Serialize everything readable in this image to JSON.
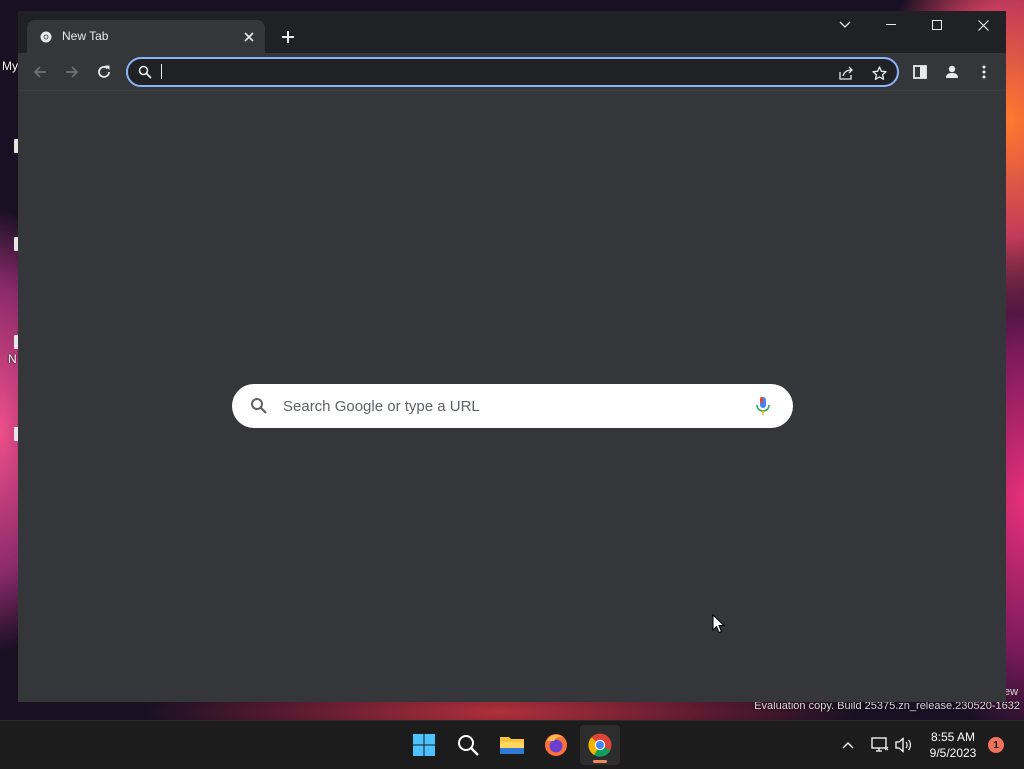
{
  "desktop": {
    "partial_label_top": "My",
    "partial_label_mid": "N",
    "watermark": "Evaluation copy. Build 25375.zn_release.230520-1632",
    "watermark_right": "ew"
  },
  "browser": {
    "tab": {
      "title": "New Tab",
      "favicon": "chrome-icon",
      "close_icon": "close-icon"
    },
    "new_tab_icon": "plus-icon",
    "window_controls": [
      "chevron-down-icon",
      "minimize-icon",
      "maximize-icon",
      "close-icon"
    ],
    "toolbar": {
      "back_icon": "arrow-left-icon",
      "forward_icon": "arrow-right-icon",
      "reload_icon": "reload-icon",
      "omnibox_value": "",
      "omnibox_icon": "search-icon",
      "share_icon": "share-icon",
      "bookmark_icon": "star-icon",
      "side_panel_icon": "side-panel-icon",
      "profile_icon": "profile-icon",
      "menu_icon": "kebab-menu-icon"
    },
    "new_tab_page": {
      "search_placeholder": "Search Google or type a URL",
      "search_icon": "search-icon",
      "mic_icon": "microphone-icon"
    }
  },
  "taskbar": {
    "apps": [
      "windows-start-icon",
      "search-icon",
      "file-explorer-icon",
      "firefox-icon",
      "chrome-icon"
    ],
    "active_app": "chrome-icon",
    "tray": [
      "chevron-up-icon",
      "network-icon",
      "speaker-icon"
    ],
    "time": "8:55 AM",
    "date": "9/5/2023",
    "notification_count": "1"
  },
  "colors": {
    "omnibox_focus": "#8ab4f8",
    "content_bg": "#35363a",
    "frame_bg": "#202124",
    "taskbar_bg": "#1c1c1c",
    "notification_badge": "#f0725a"
  }
}
